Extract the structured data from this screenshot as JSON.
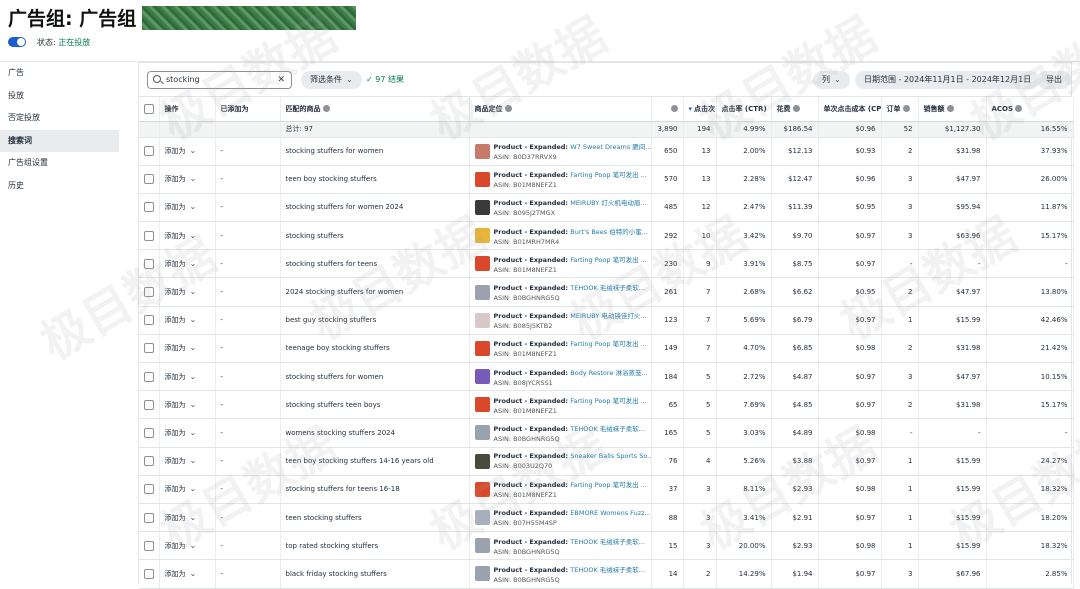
{
  "header": {
    "title": "广告组: 广告组 -",
    "status_label": "状态:",
    "status_value": "正在投放"
  },
  "sidebar": {
    "items": [
      {
        "label": "广告",
        "active": false
      },
      {
        "label": "投放",
        "active": false
      },
      {
        "label": "否定投放",
        "active": false
      },
      {
        "label": "搜索词",
        "active": true
      },
      {
        "label": "广告组设置",
        "active": false
      },
      {
        "label": "历史",
        "active": false
      }
    ]
  },
  "toolbar": {
    "search_value": "stocking",
    "filter_label": "筛选条件",
    "result_text": "97 结果",
    "columns_label": "列",
    "date_range": "日期范围 - 2024年11月1日 - 2024年12月1日",
    "export_label": "导出"
  },
  "columns": [
    "操作",
    "已添加为",
    "匹配的商品",
    "商品定位",
    "",
    "点击次",
    "点击率 (CTR)",
    "花费",
    "单次点击成本 (CPC)",
    "订单",
    "销售额",
    "ACOS"
  ],
  "total": {
    "label": "总计: 97",
    "impressions": "3,890",
    "clicks": "194",
    "ctr": "4.99%",
    "spend": "$186.54",
    "cpc": "$0.96",
    "orders": "52",
    "sales": "$1,127.30",
    "acos": "16.55%"
  },
  "action_label": "添加为",
  "rows": [
    {
      "term": "stocking stuffers for women",
      "brand": "W7 Sweet Dreams 腮间...",
      "asin": "ASIN: B0D37RRVX9",
      "thumb": "#c87a6a",
      "impressions": "650",
      "clicks": "13",
      "ctr": "2.00%",
      "spend": "$12.13",
      "cpc": "$0.93",
      "orders": "2",
      "sales": "$31.98",
      "acos": "37.93%"
    },
    {
      "term": "teen boy stocking stuffers",
      "brand": "Farting Poop 笔可发出 ...",
      "asin": "ASIN: B01M8NEFZ1",
      "thumb": "#d9482b",
      "impressions": "570",
      "clicks": "13",
      "ctr": "2.28%",
      "spend": "$12.47",
      "cpc": "$0.96",
      "orders": "3",
      "sales": "$47.97",
      "acos": "26.00%"
    },
    {
      "term": "stocking stuffers for women 2024",
      "brand": "MEIRUBY 灯火机电动眉...",
      "asin": "ASIN: B095J2TMGX",
      "thumb": "#3a3a3a",
      "impressions": "485",
      "clicks": "12",
      "ctr": "2.47%",
      "spend": "$11.39",
      "cpc": "$0.95",
      "orders": "3",
      "sales": "$95.94",
      "acos": "11.87%"
    },
    {
      "term": "stocking stuffers",
      "brand": "Burt's Bees 伯特的小蜜...",
      "asin": "ASIN: B01MRH7MR4",
      "thumb": "#e8b43a",
      "impressions": "292",
      "clicks": "10",
      "ctr": "3.42%",
      "spend": "$9.70",
      "cpc": "$0.97",
      "orders": "3",
      "sales": "$63.96",
      "acos": "15.17%"
    },
    {
      "term": "stocking stuffers for teens",
      "brand": "Farting Poop 笔可发出 ...",
      "asin": "ASIN: B01M8NEFZ1",
      "thumb": "#d9482b",
      "impressions": "230",
      "clicks": "9",
      "ctr": "3.91%",
      "spend": "$8.75",
      "cpc": "$0.97",
      "orders": "-",
      "sales": "-",
      "acos": "-"
    },
    {
      "term": "2024 stocking stuffers for women",
      "brand": "TEHOOK 毛绒袜子柔软...",
      "asin": "ASIN: B0BGHNRG5Q",
      "thumb": "#9aa2b0",
      "impressions": "261",
      "clicks": "7",
      "ctr": "2.68%",
      "spend": "$6.62",
      "cpc": "$0.95",
      "orders": "2",
      "sales": "$47.97",
      "acos": "13.80%"
    },
    {
      "term": "best guy stocking stuffers",
      "brand": "MEIRUBY 电动镜佳打火...",
      "asin": "ASIN: B085J5KTB2",
      "thumb": "#d8c8c8",
      "impressions": "123",
      "clicks": "7",
      "ctr": "5.69%",
      "spend": "$6.79",
      "cpc": "$0.97",
      "orders": "1",
      "sales": "$15.99",
      "acos": "42.46%"
    },
    {
      "term": "teenage boy stocking stuffers",
      "brand": "Farting Poop 笔可发出 ...",
      "asin": "ASIN: B01M8NEFZ1",
      "thumb": "#d9482b",
      "impressions": "149",
      "clicks": "7",
      "ctr": "4.70%",
      "spend": "$6.85",
      "cpc": "$0.98",
      "orders": "2",
      "sales": "$31.98",
      "acos": "21.42%"
    },
    {
      "term": "stocking stuffers for women",
      "brand": "Body Restore 淋浴蒸笼...",
      "asin": "ASIN: B08JYCRSS1",
      "thumb": "#7a5ab8",
      "impressions": "184",
      "clicks": "5",
      "ctr": "2.72%",
      "spend": "$4.87",
      "cpc": "$0.97",
      "orders": "3",
      "sales": "$47.97",
      "acos": "10.15%"
    },
    {
      "term": "stocking stuffers teen boys",
      "brand": "Farting Poop 笔可发出 ...",
      "asin": "ASIN: B01M8NEFZ1",
      "thumb": "#d9482b",
      "impressions": "65",
      "clicks": "5",
      "ctr": "7.69%",
      "spend": "$4.85",
      "cpc": "$0.97",
      "orders": "2",
      "sales": "$31.98",
      "acos": "15.17%"
    },
    {
      "term": "womens stocking stuffers 2024",
      "brand": "TEHOOK 毛绒袜子柔软...",
      "asin": "ASIN: B0BGHNRG5Q",
      "thumb": "#9aa2b0",
      "impressions": "165",
      "clicks": "5",
      "ctr": "3.03%",
      "spend": "$4.89",
      "cpc": "$0.98",
      "orders": "-",
      "sales": "-",
      "acos": "-"
    },
    {
      "term": "teen boy stocking stuffers 14-16 years old",
      "brand": "Sneaker Balls Sports So...",
      "asin": "ASIN: B003U2Q70",
      "thumb": "#4a4a3a",
      "impressions": "76",
      "clicks": "4",
      "ctr": "5.26%",
      "spend": "$3.88",
      "cpc": "$0.97",
      "orders": "1",
      "sales": "$15.99",
      "acos": "24.27%"
    },
    {
      "term": "stocking stuffers for teens 16-18",
      "brand": "Farting Poop 笔可发出 ...",
      "asin": "ASIN: B01M8NEFZ1",
      "thumb": "#d9482b",
      "impressions": "37",
      "clicks": "3",
      "ctr": "8.11%",
      "spend": "$2.93",
      "cpc": "$0.98",
      "orders": "1",
      "sales": "$15.99",
      "acos": "18.32%"
    },
    {
      "term": "teen stocking stuffers",
      "brand": "EBMORE Womens Fuzz...",
      "asin": "ASIN: B07H55M4SP",
      "thumb": "#a8b0c0",
      "impressions": "88",
      "clicks": "3",
      "ctr": "3.41%",
      "spend": "$2.91",
      "cpc": "$0.97",
      "orders": "1",
      "sales": "$15.99",
      "acos": "18.20%"
    },
    {
      "term": "top rated stocking stuffers",
      "brand": "TEHOOK 毛绒袜子柔软...",
      "asin": "ASIN: B0BGHNRG5Q",
      "thumb": "#9aa2b0",
      "impressions": "15",
      "clicks": "3",
      "ctr": "20.00%",
      "spend": "$2.93",
      "cpc": "$0.98",
      "orders": "1",
      "sales": "$15.99",
      "acos": "18.32%"
    },
    {
      "term": "black friday stocking stuffers",
      "brand": "TEHOOK 毛绒袜子柔软...",
      "asin": "ASIN: B0BGHNRG5Q",
      "thumb": "#9aa2b0",
      "impressions": "14",
      "clicks": "2",
      "ctr": "14.29%",
      "spend": "$1.94",
      "cpc": "$0.97",
      "orders": "3",
      "sales": "$67.96",
      "acos": "2.85%"
    }
  ],
  "product_prefix": "Product - Expanded:",
  "watermark_text": "极目数据"
}
